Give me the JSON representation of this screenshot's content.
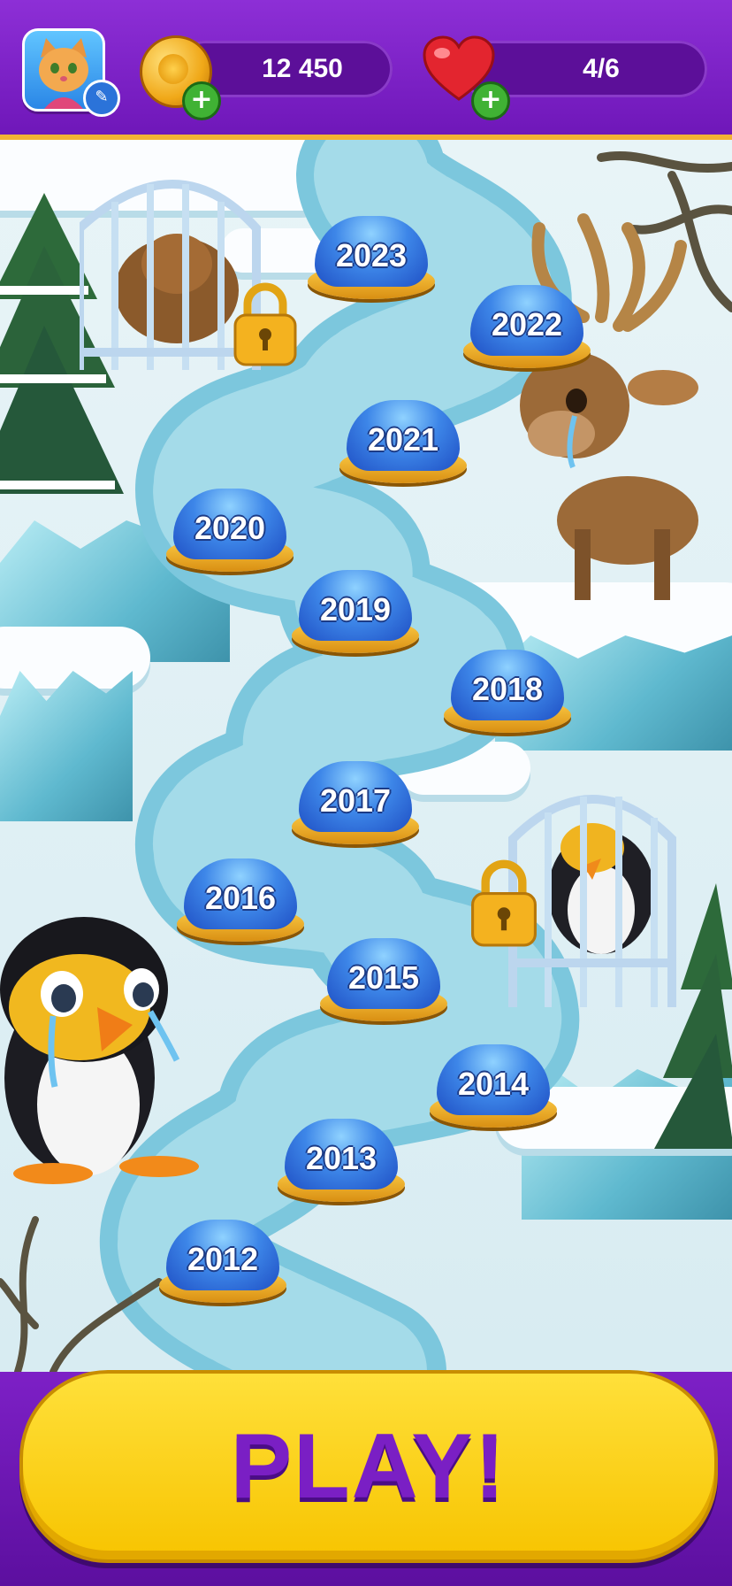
{
  "header": {
    "coins": "12 450",
    "lives": "4/6"
  },
  "map": {
    "levels": [
      {
        "label": "2023",
        "state": "available"
      },
      {
        "label": "2022",
        "state": "available",
        "partially_hidden": true
      },
      {
        "label": "2021",
        "state": "available"
      },
      {
        "label": "2020",
        "state": "available"
      },
      {
        "label": "2019",
        "state": "available"
      },
      {
        "label": "2018",
        "state": "available",
        "partially_hidden": true
      },
      {
        "label": "2017",
        "state": "available"
      },
      {
        "label": "2016",
        "state": "available"
      },
      {
        "label": "2015",
        "state": "available"
      },
      {
        "label": "2014",
        "state": "available"
      },
      {
        "label": "2013",
        "state": "available"
      },
      {
        "label": "2012",
        "state": "available"
      }
    ],
    "characters": [
      "moose-caged",
      "reindeer-crying",
      "penguin-caged",
      "penguin-crying"
    ]
  },
  "play_button": {
    "label": "PLAY!"
  },
  "colors": {
    "header_bg": "#7a22c4",
    "accent_gold": "#f2b233",
    "level_blue": "#3d86e8",
    "play_yellow": "#f7c400",
    "play_text": "#7a1fc4",
    "plus_green": "#40b234"
  },
  "icons": [
    "avatar-cat",
    "edit-pencil-icon",
    "coin-icon",
    "plus-icon",
    "heart-icon",
    "padlock-icon"
  ]
}
